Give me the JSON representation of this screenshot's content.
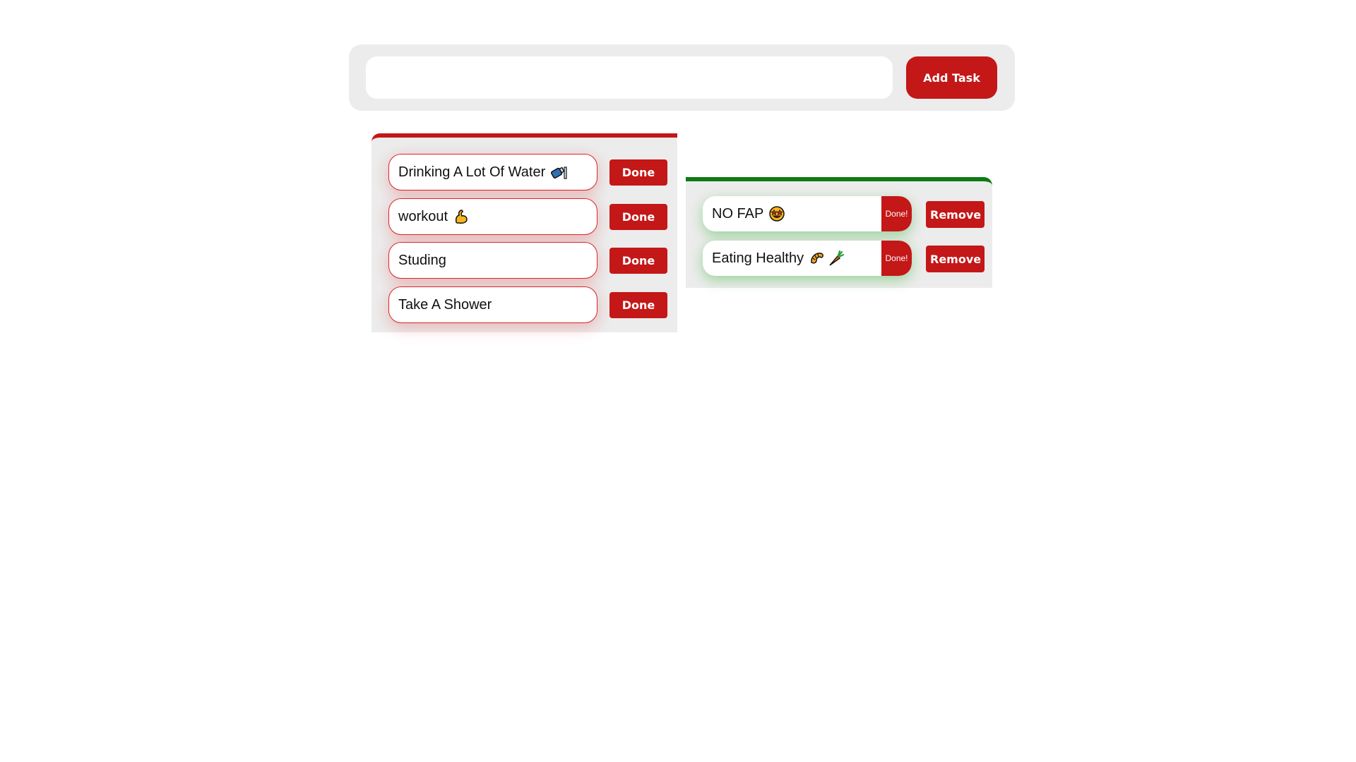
{
  "form": {
    "input_value": "",
    "input_placeholder": "",
    "add_label": "Add Task"
  },
  "colors": {
    "accent_red": "#c41717",
    "accent_green": "#0d7a12",
    "panel_bg": "#ececec"
  },
  "todo": {
    "items": [
      {
        "text": "Drinking A Lot Of Water",
        "icon": "water-bottle-icon",
        "button_label": "Done"
      },
      {
        "text": "workout",
        "icon": "flexed-bicep-icon",
        "button_label": "Done"
      },
      {
        "text": "Studing",
        "icon": "",
        "button_label": "Done"
      },
      {
        "text": "Take A Shower",
        "icon": "",
        "button_label": "Done"
      }
    ]
  },
  "done": {
    "items": [
      {
        "text": "NO FAP",
        "icons": [
          "star-struck-face-icon"
        ],
        "badge": "Done!",
        "button_label": "Remove"
      },
      {
        "text": "Eating Healthy",
        "icons": [
          "croissant-icon",
          "carrot-icon"
        ],
        "badge": "Done!",
        "button_label": "Remove"
      }
    ]
  }
}
